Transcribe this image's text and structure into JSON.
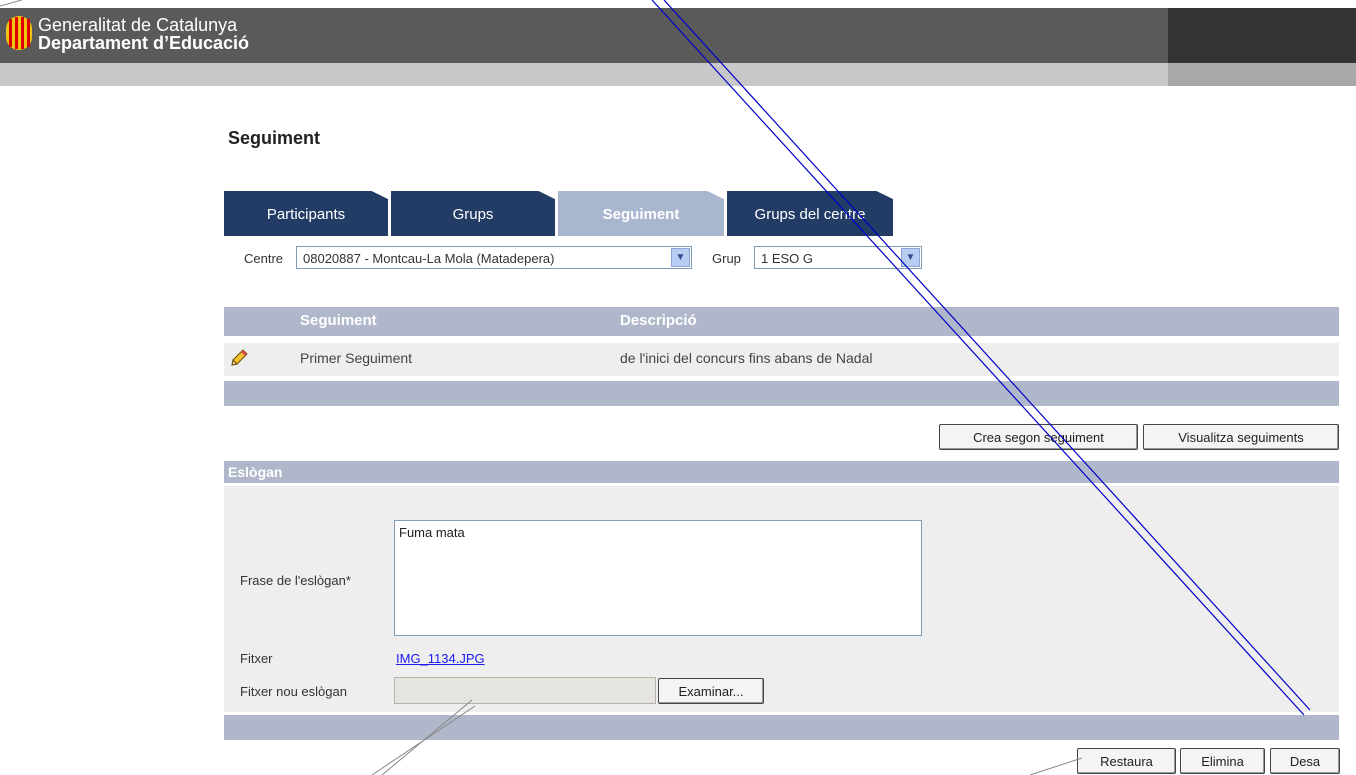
{
  "header": {
    "org_line1": "Generalitat de Catalunya",
    "org_line2": "Departament d’Educació"
  },
  "page_title": "Seguiment",
  "tabs": [
    {
      "label": "Participants",
      "active": false
    },
    {
      "label": "Grups",
      "active": false
    },
    {
      "label": "Seguiment",
      "active": true
    },
    {
      "label": "Grups del centre",
      "active": false
    }
  ],
  "filters": {
    "centre_label": "Centre",
    "centre_value": "08020887 - Montcau-La Mola (Matadepera)",
    "grup_label": "Grup",
    "grup_value": "1 ESO G"
  },
  "table": {
    "headers": [
      "Seguiment",
      "Descripció"
    ],
    "rows": [
      {
        "seguiment": "Primer Seguiment",
        "descripcio": "de l'inici del concurs fins abans de Nadal"
      }
    ]
  },
  "actions": {
    "create_second": "Crea segon seguiment",
    "view_all": "Visualitza seguiments"
  },
  "eslogan": {
    "section_title": "Eslògan",
    "frase_label": "Frase de l'eslògan*",
    "frase_value": "Fuma mata",
    "fitxer_label": "Fitxer",
    "fitxer_link": "IMG_1134.JPG",
    "nou_label": "Fitxer nou eslògan",
    "browse_button": "Examinar..."
  },
  "footer_buttons": {
    "restore": "Restaura",
    "delete": "Elimina",
    "save": "Desa"
  },
  "colors": {
    "tab_dark": "#223c66",
    "tab_active": "#a9b6cf",
    "bar": "#b1b7ca",
    "annotation_line": "#0000cc"
  }
}
